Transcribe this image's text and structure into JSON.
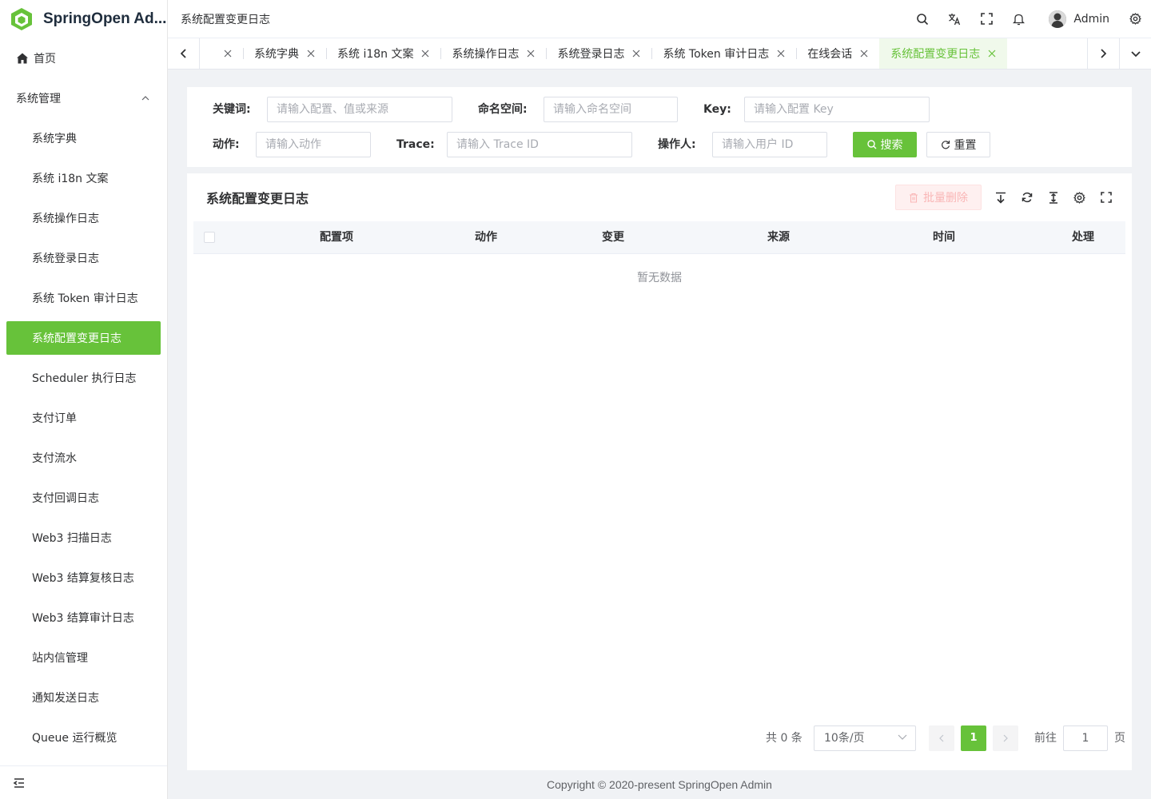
{
  "app": {
    "title": "SpringOpen Ad..."
  },
  "sidebar": {
    "home": "首页",
    "group": "系统管理",
    "items": [
      "系统字典",
      "系统 i18n 文案",
      "系统操作日志",
      "系统登录日志",
      "系统 Token 审计日志",
      "系统配置变更日志",
      "Scheduler 执行日志",
      "支付订单",
      "支付流水",
      "支付回调日志",
      "Web3 扫描日志",
      "Web3 结算复核日志",
      "Web3 结算审计日志",
      "站内信管理",
      "通知发送日志",
      "Queue 运行概览"
    ],
    "active_index": 5
  },
  "header": {
    "breadcrumb": "系统配置变更日志",
    "user_name": "Admin",
    "icons": [
      "search-icon",
      "translate-icon",
      "fullscreen-icon",
      "bell-icon",
      "settings-icon"
    ]
  },
  "tabs": {
    "items": [
      {
        "label": ""
      },
      {
        "label": "系统字典"
      },
      {
        "label": "系统 i18n 文案"
      },
      {
        "label": "系统操作日志"
      },
      {
        "label": "系统登录日志"
      },
      {
        "label": "系统 Token 审计日志"
      },
      {
        "label": "在线会话"
      },
      {
        "label": "系统配置变更日志",
        "active": true
      }
    ]
  },
  "search": {
    "keyword_label": "关键词:",
    "keyword_placeholder": "请输入配置、值或来源",
    "namespace_label": "命名空间:",
    "namespace_placeholder": "请输入命名空间",
    "key_label": "Key:",
    "key_placeholder": "请输入配置 Key",
    "action_label": "动作:",
    "action_placeholder": "请输入动作",
    "trace_label": "Trace:",
    "trace_placeholder": "请输入 Trace ID",
    "operator_label": "操作人:",
    "operator_placeholder": "请输入用户 ID",
    "search_button": "搜索",
    "reset_button": "重置"
  },
  "table": {
    "title": "系统配置变更日志",
    "batch_delete": "批量删除",
    "columns": [
      "配置项",
      "动作",
      "变更",
      "来源",
      "时间",
      "处理"
    ],
    "empty_text": "暂无数据"
  },
  "pagination": {
    "total": "共 0 条",
    "page_size": "10条/页",
    "current_page": "1",
    "goto_label": "前往",
    "goto_value": "1",
    "page_unit": "页"
  },
  "footer": {
    "copyright": "Copyright © 2020-present SpringOpen Admin"
  },
  "colors": {
    "primary": "#67c23a",
    "danger_light": "#fef0f0",
    "bg": "#f0f2f5"
  }
}
